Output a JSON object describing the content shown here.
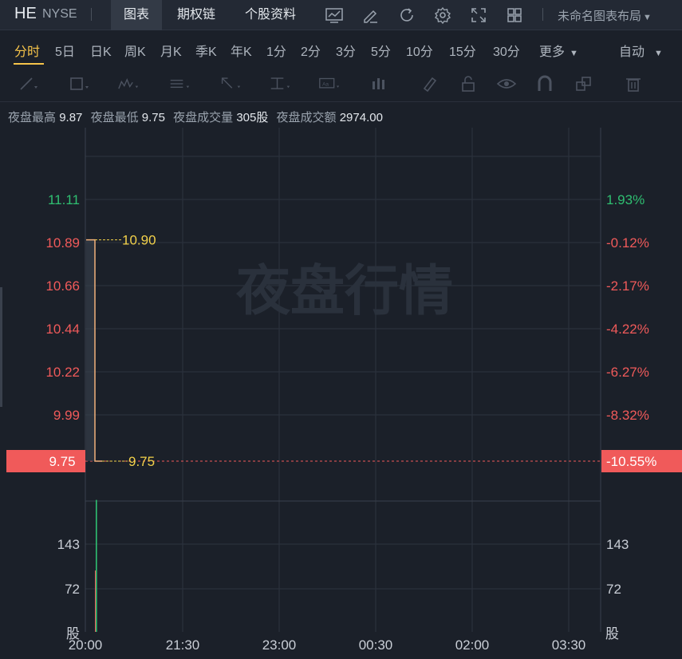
{
  "header": {
    "symbol": "HE",
    "exchange": "NYSE",
    "tabs": [
      {
        "label": "图表",
        "active": true
      },
      {
        "label": "期权链",
        "active": false
      },
      {
        "label": "个股资料",
        "active": false
      }
    ],
    "layout_label": "未命名图表布局",
    "icons": [
      "indicator-icon",
      "draw-icon",
      "refresh-icon",
      "settings-icon",
      "fullscreen-icon",
      "grid-layout-icon"
    ]
  },
  "periods": {
    "items": [
      "分时",
      "5日",
      "日K",
      "周K",
      "月K",
      "季K",
      "年K",
      "1分",
      "2分",
      "3分",
      "5分",
      "10分",
      "15分",
      "30分",
      "更多"
    ],
    "active": "分时",
    "scale_mode": "自动"
  },
  "drawing_tools": [
    "trendline-icon",
    "rectangle-icon",
    "pattern-icon",
    "fib-icon",
    "arrow-icon",
    "text-level-icon",
    "text-note-icon",
    "bar-pattern-icon",
    "brush-icon",
    "lock-icon",
    "eye-icon",
    "magnet-icon",
    "layers-icon",
    "trash-icon"
  ],
  "stats": [
    {
      "label": "夜盘最高",
      "value": "9.87"
    },
    {
      "label": "夜盘最低",
      "value": "9.75"
    },
    {
      "label": "夜盘成交量",
      "value": "305股"
    },
    {
      "label": "夜盘成交额",
      "value": "2974.00"
    }
  ],
  "watermark": "夜盘行情",
  "colors": {
    "background": "#1b2029",
    "grid": "#2c333e",
    "up": "#2fbf71",
    "down": "#f05a5a",
    "price_line": "#f2b07b",
    "label_yellow": "#f2d14a",
    "active_tab": "#f6c44a"
  },
  "chart_data": {
    "type": "line",
    "price_axis": {
      "ticks": [
        "11.11",
        "10.89",
        "10.66",
        "10.44",
        "10.22",
        "9.99"
      ],
      "range": [
        9.78,
        11.33
      ],
      "current_price": "9.75"
    },
    "percent_axis": {
      "ticks": [
        "1.93%",
        "-0.12%",
        "-2.17%",
        "-4.22%",
        "-6.27%",
        "-8.32%"
      ],
      "current_percent": "-10.55%"
    },
    "time_axis": [
      "20:00",
      "21:30",
      "23:00",
      "00:30",
      "02:00",
      "03:30"
    ],
    "price_series": {
      "x": [
        "20:00",
        "20:01",
        "20:02",
        "20:03"
      ],
      "values": [
        10.9,
        10.9,
        9.75,
        9.75
      ]
    },
    "annotations": [
      {
        "label": "10.90",
        "value": 10.9
      },
      {
        "label": "9.75",
        "value": 9.75
      }
    ],
    "volume_axis": {
      "ticks": [
        "143",
        "72"
      ],
      "unit": "股",
      "range": [
        0,
        215
      ]
    },
    "volume_bars": [
      {
        "x": "20:00",
        "value": 100,
        "color": "down"
      },
      {
        "x": "20:01",
        "value": 215,
        "color": "up"
      }
    ]
  }
}
